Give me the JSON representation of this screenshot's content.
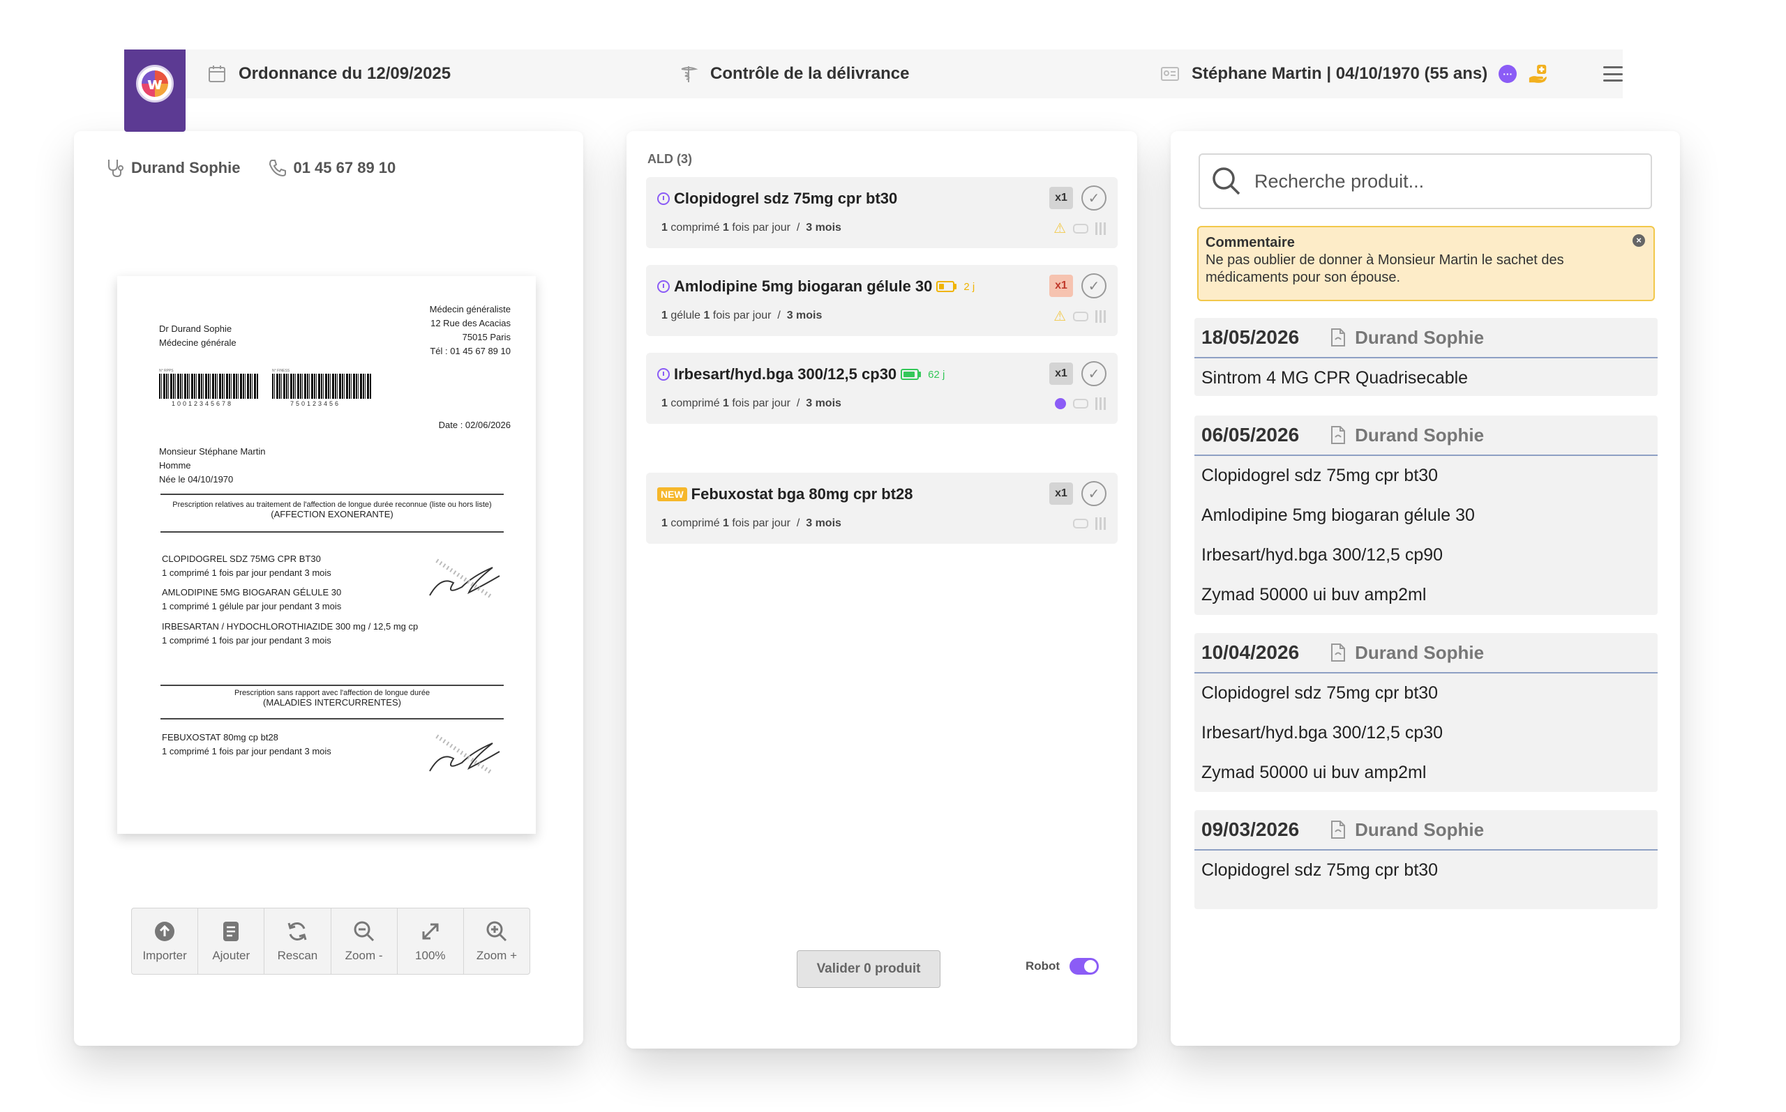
{
  "header": {
    "prescription": "Ordonnance du 12/09/2025",
    "control": "Contrôle de la délivrance",
    "patient": "Stéphane Martin | 04/10/1970 (55 ans)",
    "chat_glyph": "···"
  },
  "doctor": {
    "name": "Durand Sophie",
    "phone": "01 45 67 89 10"
  },
  "rx": {
    "doctor_name": "Dr Durand Sophie",
    "doctor_spec": "Médecine générale",
    "right_1": "Médecin généraliste",
    "right_2": "12 Rue des Acacias",
    "right_3": "75015 Paris",
    "right_4": "Tél : 01 45 67 89 10",
    "bc1_caption": "N° RPPS",
    "bc1_num": "10012345678",
    "bc2_caption": "N° FINESS",
    "bc2_num": "750123456",
    "date": "Date : 02/06/2026",
    "patient_1": "Monsieur Stéphane Martin",
    "patient_2": "Homme",
    "patient_3": "Née le 04/10/1970",
    "ald_small": "Prescription relatives au traitement de l'affection de longue durée reconnue (liste ou hors liste)",
    "ald_title": "(AFFECTION EXONERANTE)",
    "m1": "CLOPIDOGREL SDZ 75MG CPR BT30",
    "m1d": "1 comprimé 1 fois par jour pendant 3 mois",
    "m2": "AMLODIPINE 5MG BIOGARAN GÉLULE 30",
    "m2d": "1 comprimé 1 gélule par jour pendant 3 mois",
    "m3": "IRBESARTAN / HYDOCHLOROTHIAZIDE 300 mg / 12,5 mg cp",
    "m3d": "1 comprimé 1 fois par jour pendant 3 mois",
    "nonald_small": "Prescription sans rapport avec l'affection de longue durée",
    "nonald_title": "(MALADIES INTERCURRENTES)",
    "m4": "FEBUXOSTAT 80mg cp bt28",
    "m4d": "1 comprimé 1 fois par jour pendant 3 mois"
  },
  "toolbar": {
    "import": "Importer",
    "add": "Ajouter",
    "rescan": "Rescan",
    "zoom_out": "Zoom -",
    "zoom_level": "100%",
    "zoom_in": "Zoom +"
  },
  "delivery": {
    "ald_title": "ALD (3)",
    "items": [
      {
        "name": "Clopidogrel sdz 75mg cpr bt30",
        "dose_qty": "1",
        "dose_unit": "comprimé",
        "freq_qty": "1",
        "freq_text": "fois par jour",
        "duration": "3 mois",
        "qty": "x1"
      },
      {
        "name": "Amlodipine 5mg biogaran gélule 30",
        "dose_qty": "1",
        "dose_unit": "gélule",
        "freq_qty": "1",
        "freq_text": "fois par jour",
        "duration": "3 mois",
        "qty": "x1",
        "stock_days": "2 j",
        "stock_level": 0.35
      },
      {
        "name": "Irbesart/hyd.bga 300/12,5 cp30",
        "dose_qty": "1",
        "dose_unit": "comprimé",
        "freq_qty": "1",
        "freq_text": "fois par jour",
        "duration": "3 mois",
        "qty": "x1",
        "stock_days": "62 j",
        "stock_level": 0.9
      },
      {
        "badge": "NEW",
        "name": "Febuxostat bga 80mg cpr bt28",
        "dose_qty": "1",
        "dose_unit": "comprimé",
        "freq_qty": "1",
        "freq_text": "fois par jour",
        "duration": "3 mois",
        "qty": "x1"
      }
    ],
    "dose_sep": "/",
    "validate": "Valider 0 produit",
    "robot": "Robot"
  },
  "search": {
    "placeholder": "Recherche produit..."
  },
  "comment": {
    "title": "Commentaire",
    "text": "Ne pas oublier de donner à Monsieur Martin le sachet des médicaments pour son épouse."
  },
  "history": [
    {
      "date": "18/05/2026",
      "doctor": "Durand Sophie",
      "items": [
        "Sintrom 4 MG CPR Quadrisecable"
      ]
    },
    {
      "date": "06/05/2026",
      "doctor": "Durand Sophie",
      "items": [
        "Clopidogrel sdz 75mg cpr bt30",
        "Amlodipine 5mg biogaran gélule 30",
        "Irbesart/hyd.bga 300/12,5 cp90",
        "Zymad 50000 ui buv amp2ml"
      ]
    },
    {
      "date": "10/04/2026",
      "doctor": "Durand Sophie",
      "items": [
        "Clopidogrel sdz 75mg cpr bt30",
        "Irbesart/hyd.bga 300/12,5 cp30",
        "Zymad 50000 ui buv amp2ml"
      ]
    },
    {
      "date": "09/03/2026",
      "doctor": "Durand Sophie",
      "items": [
        "Clopidogrel sdz 75mg cpr bt30"
      ]
    }
  ],
  "colors": {
    "brand": "#5c3a93",
    "accent": "#8b5cf6",
    "comment_bg": "#fdecc8",
    "warning": "#f2c94c",
    "stock_low": "#f0b400",
    "stock_ok": "#34c759"
  }
}
